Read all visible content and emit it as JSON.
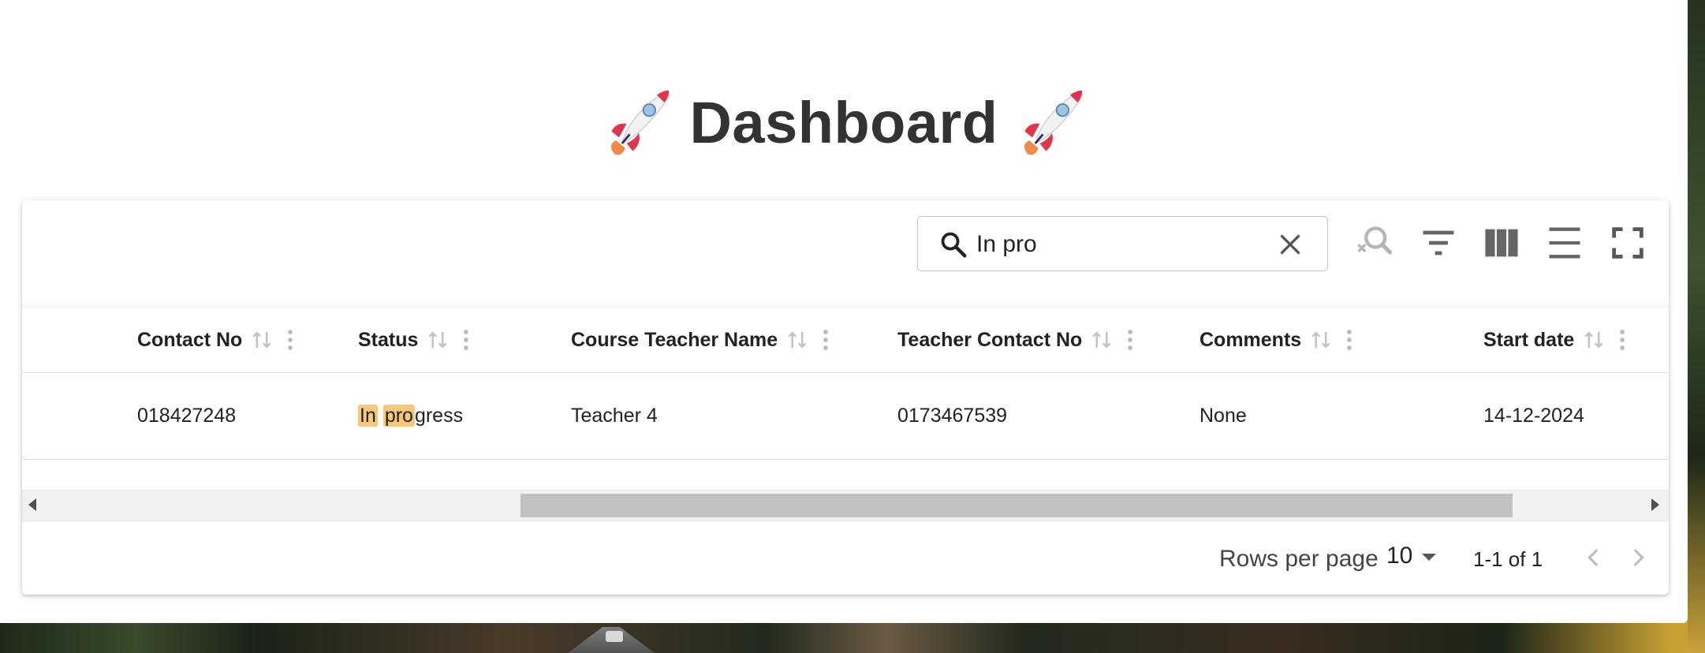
{
  "page": {
    "title": "Dashboard",
    "title_icon": "rocket-icon"
  },
  "toolbar": {
    "search": {
      "value": "In pro",
      "placeholder": "Search"
    },
    "icons": [
      "search-off-icon",
      "filter-icon",
      "columns-icon",
      "density-icon",
      "fullscreen-icon"
    ]
  },
  "table": {
    "columns": [
      {
        "label": "Contact No"
      },
      {
        "label": "Status"
      },
      {
        "label": "Course Teacher Name"
      },
      {
        "label": "Teacher Contact No"
      },
      {
        "label": "Comments"
      },
      {
        "label": "Start date"
      }
    ],
    "rows": [
      {
        "contact_no": "018427248",
        "status": {
          "hl1": "In",
          "sep": " ",
          "hl2": "pro",
          "rest": "gress"
        },
        "course_teacher_name": "Teacher 4",
        "teacher_contact_no": "0173467539",
        "comments": "None",
        "start_date": "14-12-2024"
      }
    ]
  },
  "pagination": {
    "rows_per_page_label": "Rows per page",
    "rows_per_page_value": "10",
    "page_info": "1-1 of 1"
  },
  "colors": {
    "highlight": "#f5c87a",
    "title": "#333333"
  }
}
